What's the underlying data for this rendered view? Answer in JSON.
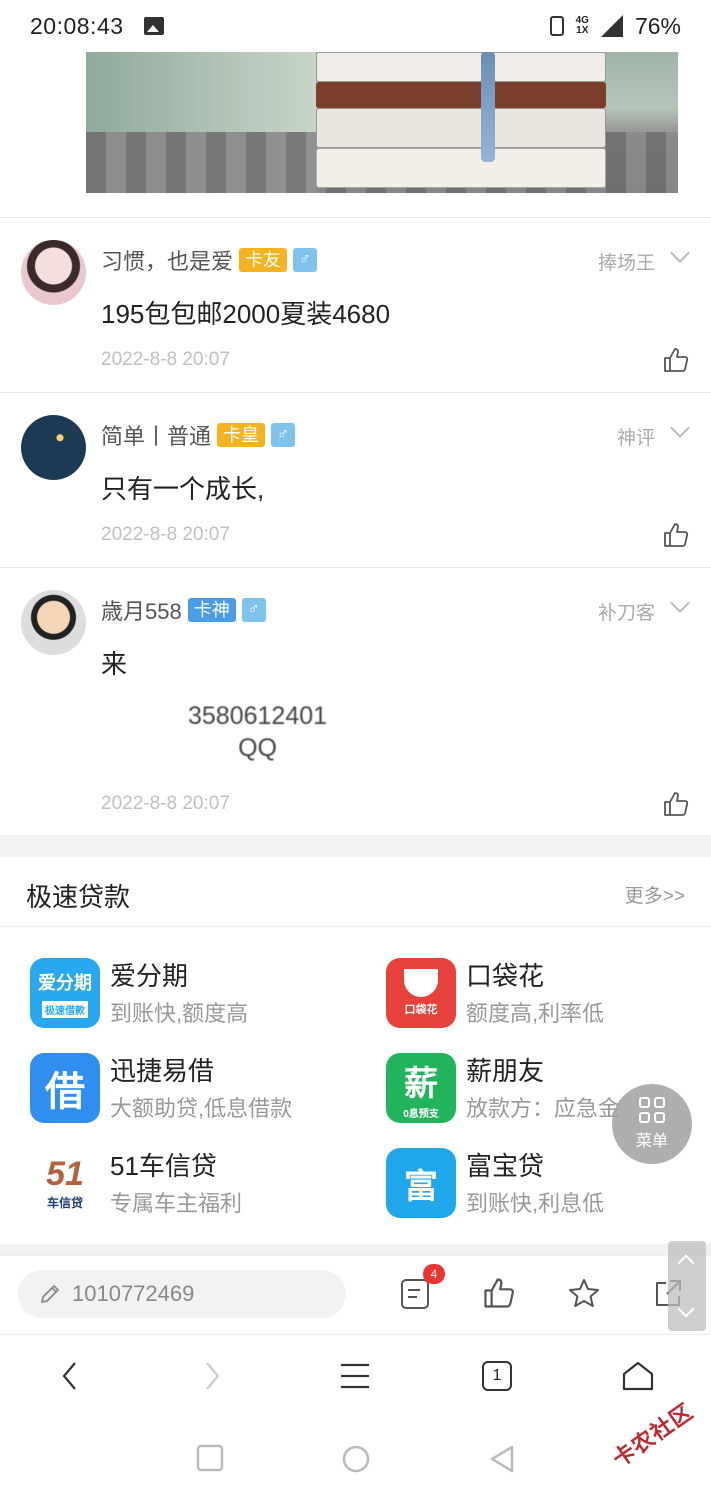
{
  "status_bar": {
    "time": "20:08:43",
    "network": "4G",
    "network_sub": "1X",
    "battery": "76%"
  },
  "posts": [
    {
      "username": "习惯，也是爱",
      "level": "卡友",
      "gender": "♂",
      "rank": "捧场王",
      "content": "195包包邮2000夏装4680",
      "date": "2022-8-8 20:07"
    },
    {
      "username": "简单丨普通",
      "level": "卡皇",
      "gender": "♂",
      "rank": "神评",
      "content": "只有一个成长,",
      "date": "2022-8-8 20:07"
    },
    {
      "username": "歳月558",
      "level": "卡神",
      "gender": "♂",
      "rank": "补刀客",
      "content": "来",
      "qq_number": "3580612401",
      "qq_label": "QQ",
      "date": "2022-8-8 20:07"
    }
  ],
  "loans_section": {
    "title": "极速贷款",
    "more": "更多>>",
    "items": [
      {
        "name": "爱分期",
        "desc": "到账快,额度高",
        "icon_text": "爱分期",
        "icon_sub": "极速借款",
        "color": "#27a8f0"
      },
      {
        "name": "口袋花",
        "desc": "额度高,利率低",
        "icon_text": "口袋花",
        "color": "#e8403a"
      },
      {
        "name": "迅捷易借",
        "desc": "大额助贷,低息借款",
        "icon_text": "借",
        "color": "#2f8ef0"
      },
      {
        "name": "薪朋友",
        "desc": "放款方：应急金",
        "icon_text": "薪",
        "icon_sub": "0息预支",
        "color": "#22b45c"
      },
      {
        "name": "51车信贷",
        "desc": "专属车主福利",
        "icon_text": "51",
        "icon_sub": "车信贷",
        "color": "#ffffff"
      },
      {
        "name": "富宝贷",
        "desc": "到账快,利息低",
        "icon_text": "富",
        "color": "#20a6ea"
      }
    ]
  },
  "menu_fab": {
    "label": "菜单"
  },
  "comment_bar": {
    "input_value": "1010772469",
    "notif_count": "4"
  },
  "browser_nav": {
    "tab_count": "1"
  },
  "watermark": "卡农社区"
}
